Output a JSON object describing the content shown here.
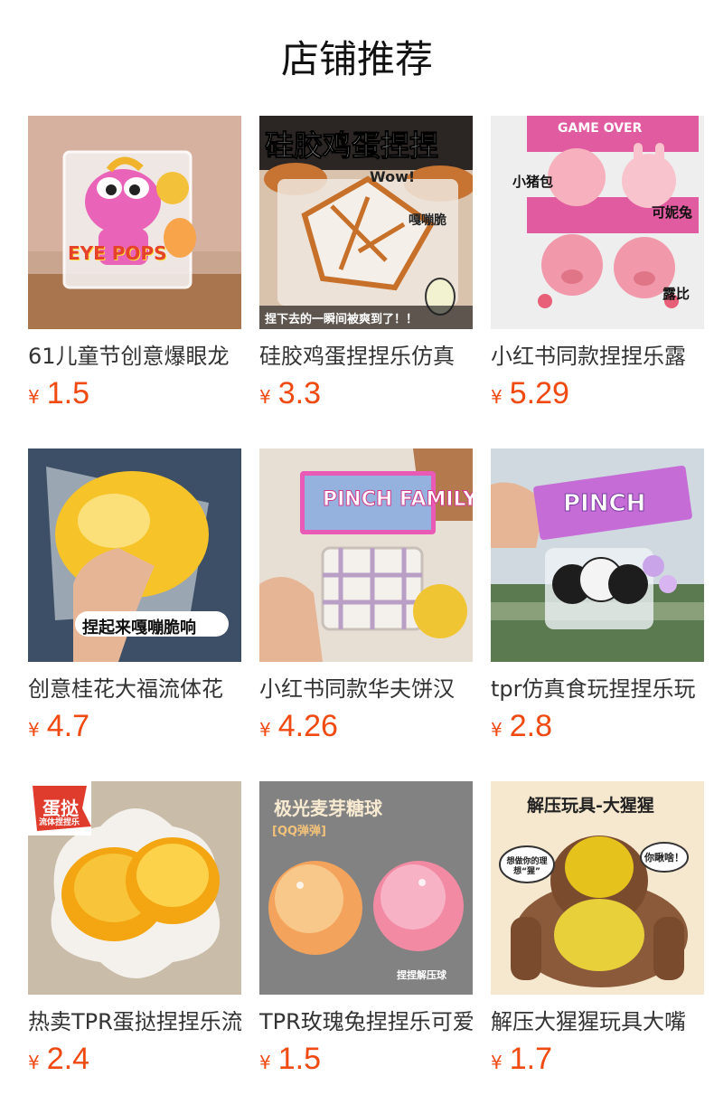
{
  "section_title": "店铺推荐",
  "products": [
    {
      "name": "61儿童节创意爆眼龙",
      "currency": "¥",
      "price": "1.5",
      "image_text": [
        "EYE POPS"
      ],
      "colors": {
        "bg": "#c9a48e",
        "accent": "#e964b8"
      }
    },
    {
      "name": "硅胶鸡蛋捏捏乐仿真",
      "currency": "¥",
      "price": "3.3",
      "image_text": [
        "硅胶鸡蛋捏捏",
        "Wow!",
        "嘎嘣脆",
        "捏下去的一瞬间被爽到了！！"
      ],
      "colors": {
        "bg": "#d9c3ad",
        "accent": "#e2781f"
      }
    },
    {
      "name": "小红书同款捏捏乐露",
      "currency": "¥",
      "price": "5.29",
      "image_text": [
        "GAME OVER",
        "小猪包",
        "可妮兔",
        "露比"
      ],
      "colors": {
        "bg": "#eeeeee",
        "accent": "#f2a2b0"
      }
    },
    {
      "name": "创意桂花大福流体花",
      "currency": "¥",
      "price": "4.7",
      "image_text": [
        "捏起来嘎嘣脆响"
      ],
      "colors": {
        "bg": "#3d4f66",
        "accent": "#f6c429"
      }
    },
    {
      "name": "小红书同款华夫饼汉",
      "currency": "¥",
      "price": "4.26",
      "image_text": [
        "PINCH FAMILY"
      ],
      "colors": {
        "bg": "#e8dfd4",
        "accent": "#e85ab5"
      }
    },
    {
      "name": "tpr仿真食玩捏捏乐玩",
      "currency": "¥",
      "price": "2.8",
      "image_text": [
        "PINCH"
      ],
      "colors": {
        "bg": "#cfd9df",
        "accent": "#8b5bd6"
      }
    },
    {
      "name": "热卖TPR蛋挞捏捏乐流",
      "currency": "¥",
      "price": "2.4",
      "image_text": [
        "蛋挞",
        "流体捏捏乐"
      ],
      "colors": {
        "bg": "#c9bca9",
        "accent": "#f3a512"
      }
    },
    {
      "name": "TPR玫瑰兔捏捏乐可爱",
      "currency": "¥",
      "price": "1.5",
      "image_text": [
        "极光麦芽糖球",
        "[QQ弹弹]",
        "捏捏解压球"
      ],
      "colors": {
        "bg": "#7b7b7b",
        "accent": "#f4a35c"
      }
    },
    {
      "name": "解压大猩猩玩具大嘴",
      "currency": "¥",
      "price": "1.7",
      "image_text": [
        "解压玩具-大猩猩",
        "想做你的理想“猩”",
        "你瞅啥！"
      ],
      "colors": {
        "bg": "#f6e8cf",
        "accent": "#e6c21d"
      }
    }
  ]
}
